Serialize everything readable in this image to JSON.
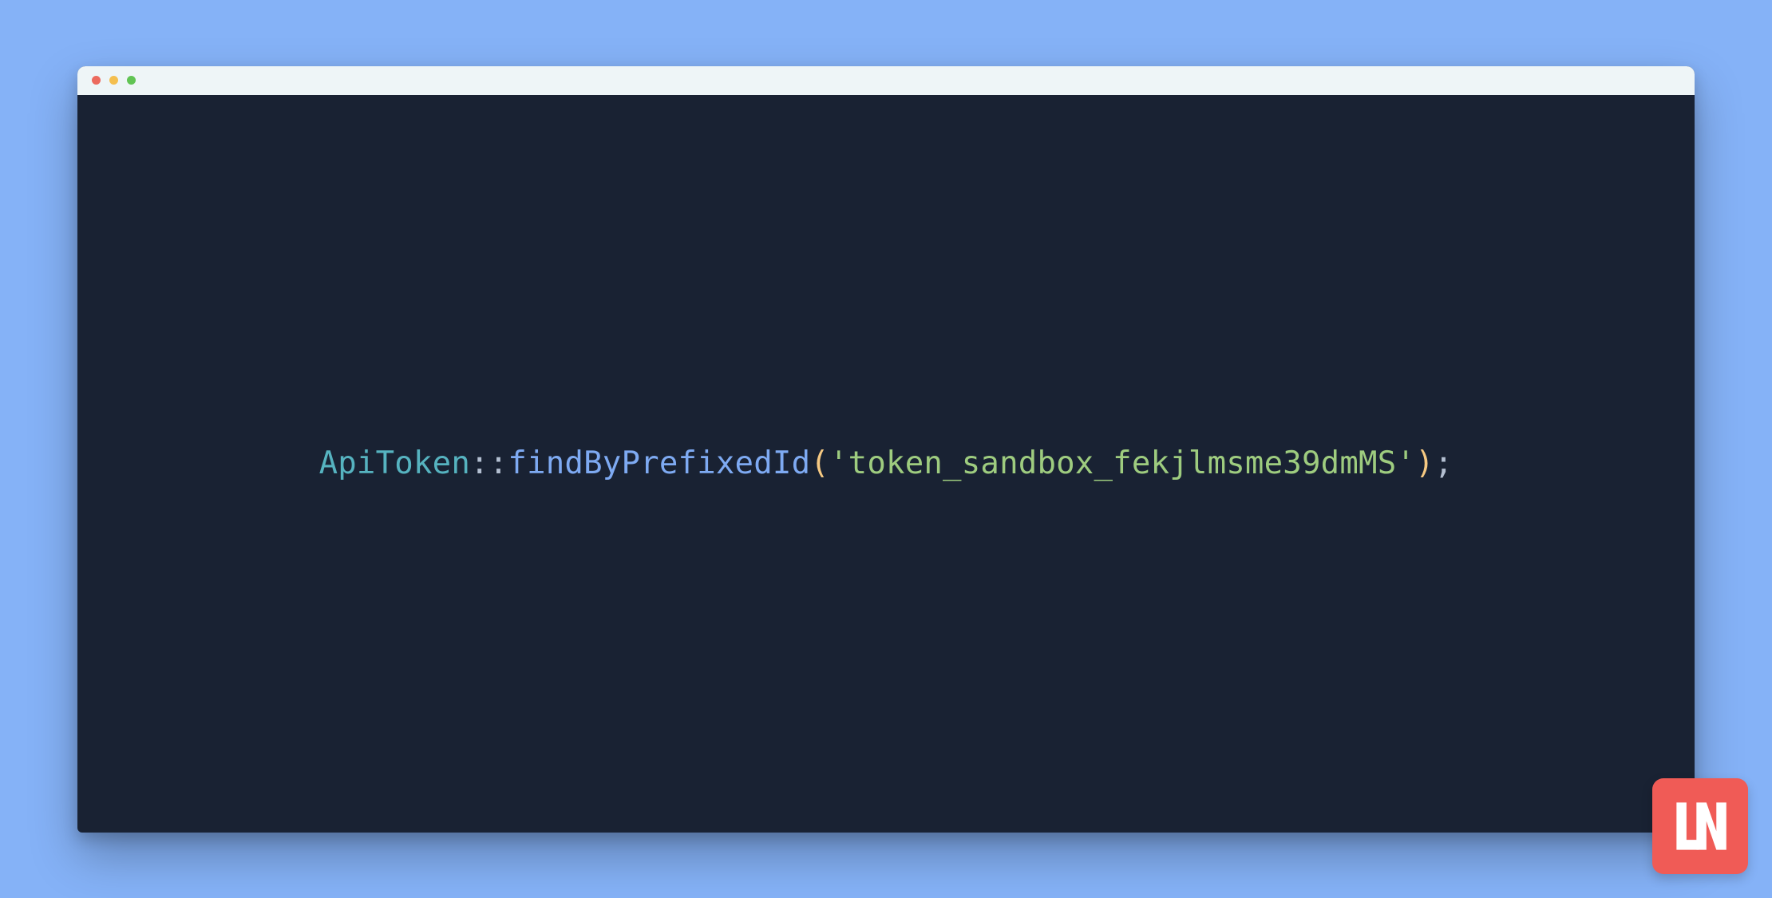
{
  "code": {
    "class": "ApiToken",
    "scope": "::",
    "method": "findByPrefixedId",
    "open_paren": "(",
    "string": "'token_sandbox_fekjlmsme39dmMS'",
    "close_paren": ")",
    "semi": ";"
  },
  "brand": {
    "label": "LN"
  },
  "colors": {
    "page_bg": "#85b2f7",
    "editor_bg": "#192233",
    "titlebar_bg": "#eef5f7",
    "class": "#56b3c0",
    "method": "#7eaaf2",
    "string": "#9ecc7f",
    "paren": "#f6c982",
    "badge": "#f05b56"
  }
}
